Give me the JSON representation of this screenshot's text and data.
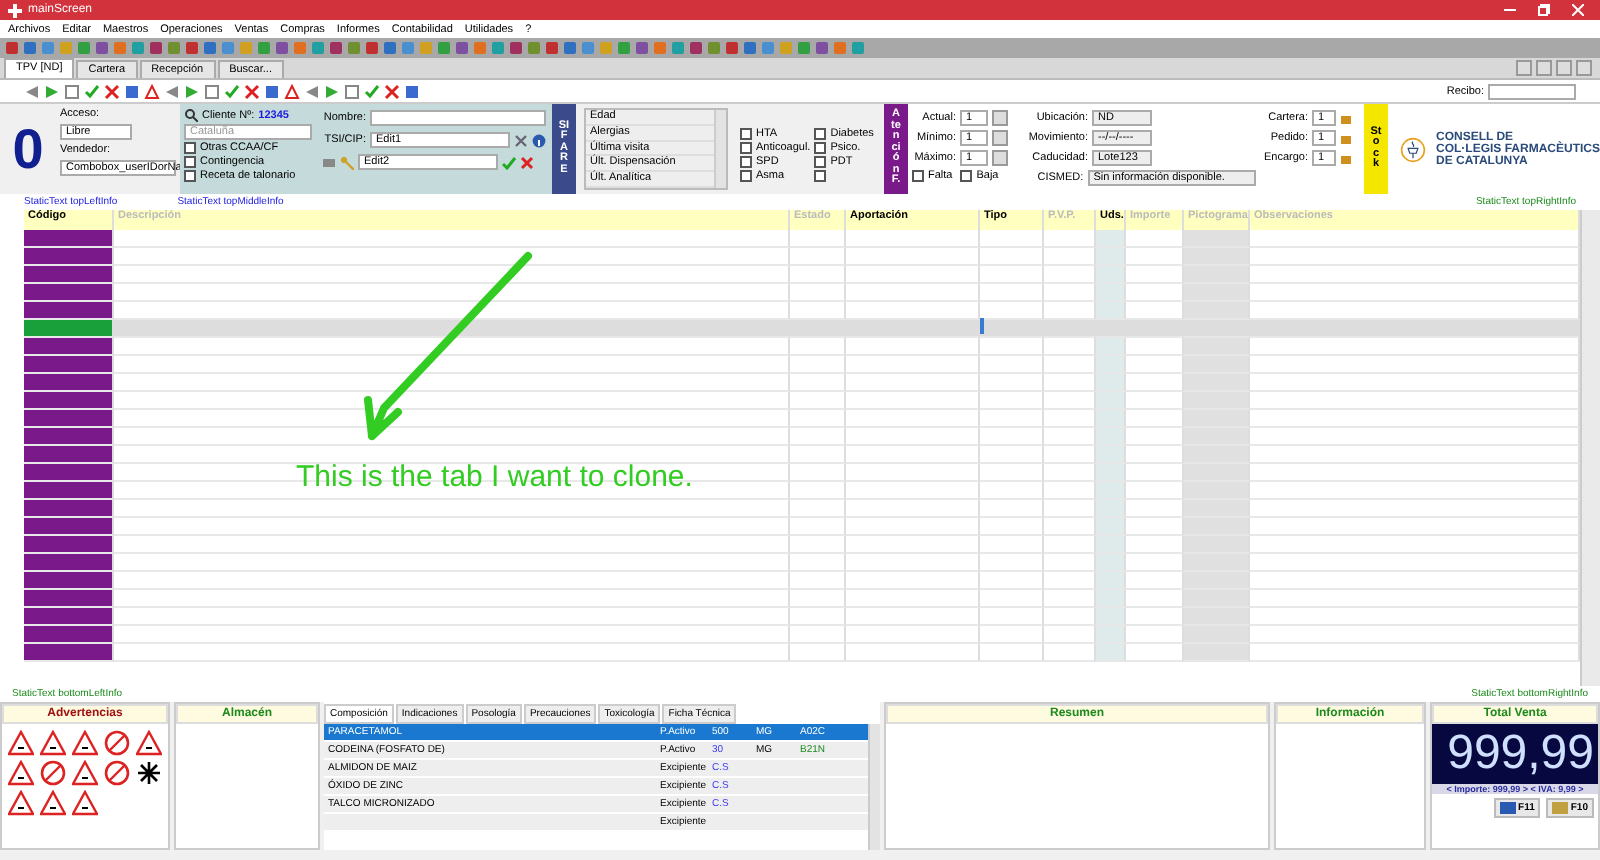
{
  "window": {
    "title": "mainScreen"
  },
  "menu": [
    "Archivos",
    "Editar",
    "Maestros",
    "Operaciones",
    "Ventas",
    "Compras",
    "Informes",
    "Contabilidad",
    "Utilidades",
    "?"
  ],
  "doc_tabs": [
    {
      "label": "TPV [ND]",
      "selected": true
    },
    {
      "label": "Cartera",
      "selected": false
    },
    {
      "label": "Recepción",
      "selected": false
    },
    {
      "label": "Buscar...",
      "selected": false
    }
  ],
  "recibo": {
    "label": "Recibo:"
  },
  "header": {
    "counter": "0",
    "acceso_label": "Acceso:",
    "acceso_value": "Libre",
    "vendedor_label": "Vendedor:",
    "vendedor_value": "Combobox_userIDorNa",
    "cliente_label": "Cliente Nº:",
    "cliente_number": "12345",
    "region": "Cataluña",
    "options": [
      {
        "label": "Otras CCAA/CF",
        "checked": false
      },
      {
        "label": "Contingencia",
        "checked": false
      },
      {
        "label": "Receta de talonario",
        "checked": false
      }
    ],
    "nombre_label": "Nombre:",
    "tsi_label": "TSI/CIP:",
    "tsi_value": "Edit1",
    "edit2_value": "Edit2",
    "sifare": "SIFARE",
    "history": [
      "Edad",
      "Alergias",
      "Última visita",
      "Últ. Dispensación",
      "Últ. Analítica"
    ],
    "conditions": [
      {
        "label": "HTA",
        "checked": false
      },
      {
        "label": "Diabetes",
        "checked": false
      },
      {
        "label": "Anticoagul.",
        "checked": false
      },
      {
        "label": "Psico.",
        "checked": false
      },
      {
        "label": "SPD",
        "checked": false
      },
      {
        "label": "PDT",
        "checked": false
      },
      {
        "label": "Asma",
        "checked": false
      },
      {
        "checked": false
      }
    ],
    "atencion": "Atención F."
  },
  "stock": {
    "rows": [
      {
        "label": "Actual:",
        "value": "1"
      },
      {
        "label": "Mínimo:",
        "value": "1"
      },
      {
        "label": "Máximo:",
        "value": "1"
      }
    ],
    "flags": [
      {
        "label": "Falta",
        "checked": false
      },
      {
        "label": "Baja",
        "checked": false
      }
    ]
  },
  "location": [
    {
      "label": "Ubicación:",
      "value": "ND"
    },
    {
      "label": "Movimiento:",
      "value": "--/--/----"
    },
    {
      "label": "Caducidad:",
      "value": "Lote123"
    }
  ],
  "cismed": {
    "label": "CISMED:",
    "value": "Sin información disponible."
  },
  "orders": [
    {
      "label": "Cartera:",
      "value": "1"
    },
    {
      "label": "Pedido:",
      "value": "1"
    },
    {
      "label": "Encargo:",
      "value": "1"
    }
  ],
  "stock_tab": "Stock",
  "logo": [
    "CONSELL DE",
    "COL·LEGIS FARMACÈUTICS",
    "DE CATALUNYA"
  ],
  "info": {
    "top_left": "StaticText topLeftInfo",
    "top_middle": "StaticText topMiddleInfo",
    "top_right": "StaticText topRightInfo",
    "bottom_left": "StaticText bottomLeftInfo",
    "bottom_right": "StaticText bottomRightInfo"
  },
  "grid": {
    "columns": [
      "Código",
      "Descripción",
      "Estado",
      "Aportación",
      "Tipo",
      "P.V.P.",
      "Uds.",
      "Importe",
      "Pictograma",
      "Observaciones"
    ],
    "rows": [
      {
        "selected": false
      },
      {
        "selected": false
      },
      {
        "selected": false
      },
      {
        "selected": false
      },
      {
        "selected": false
      },
      {
        "selected": true
      },
      {
        "selected": false
      },
      {
        "selected": false
      },
      {
        "selected": false
      },
      {
        "selected": false
      },
      {
        "selected": false
      },
      {
        "selected": false
      },
      {
        "selected": false
      },
      {
        "selected": false
      },
      {
        "selected": false
      },
      {
        "selected": false
      },
      {
        "selected": false
      },
      {
        "selected": false
      },
      {
        "selected": false
      },
      {
        "selected": false
      },
      {
        "selected": false
      },
      {
        "selected": false
      },
      {
        "selected": false
      },
      {
        "selected": false
      }
    ]
  },
  "panels": {
    "warnings_title": "Advertencias",
    "store_title": "Almacén",
    "composition": {
      "tabs": [
        {
          "label": "Composición",
          "selected": true
        },
        {
          "label": "Indicaciones",
          "selected": false
        },
        {
          "label": "Posología",
          "selected": false
        },
        {
          "label": "Precauciones",
          "selected": false
        },
        {
          "label": "Toxicología",
          "selected": false
        },
        {
          "label": "Ficha Técnica",
          "selected": false
        }
      ],
      "rows": [
        {
          "name": "PARACETAMOL",
          "role": "P.Activo",
          "amount": "500",
          "unit": "MG",
          "code": "A02C",
          "selected": true
        },
        {
          "name": "CODEINA (FOSFATO DE)",
          "role": "P.Activo",
          "amount": "30",
          "unit": "MG",
          "code": "B21N",
          "selected": false
        },
        {
          "name": "ALMIDON DE MAIZ",
          "role": "Excipiente",
          "amount": "C.S",
          "selected": false
        },
        {
          "name": "ÓXIDO DE ZINC",
          "role": "Excipiente",
          "amount": "C.S",
          "selected": false
        },
        {
          "name": "TALCO MICRONIZADO",
          "role": "Excipiente",
          "amount": "C.S",
          "selected": false
        },
        {
          "role": "Excipiente",
          "selected": false
        }
      ]
    },
    "summary_title": "Resumen",
    "info_title": "Información",
    "total": {
      "title": "Total Venta",
      "amount": "999,99",
      "detail": "< Importe: 999,99 > < IVA: 9,99 >",
      "keys": [
        "F11",
        "F10"
      ]
    }
  },
  "annotation": {
    "text": "This is the tab I want to clone."
  }
}
